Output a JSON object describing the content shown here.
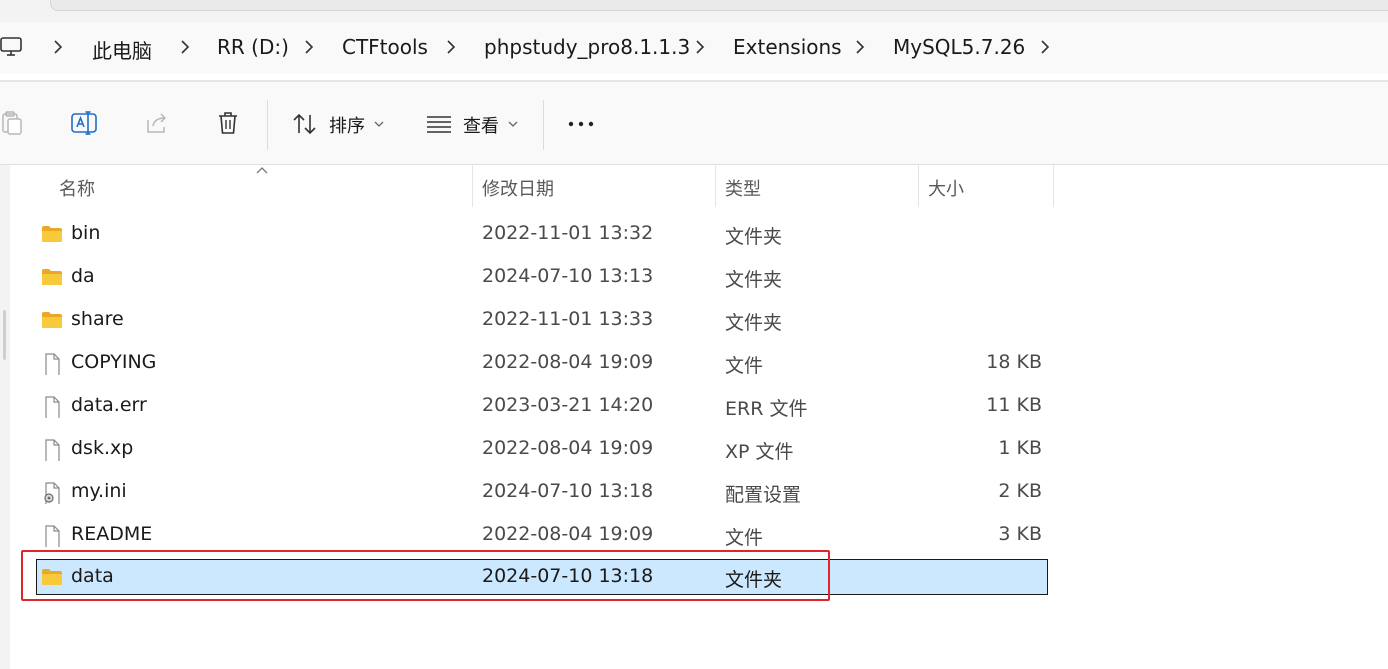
{
  "breadcrumb": {
    "items": [
      "此电脑",
      "RR (D:)",
      "CTFtools",
      "phpstudy_pro8.1.1.3",
      "Extensions",
      "MySQL5.7.26"
    ]
  },
  "toolbar": {
    "sort_label": "排序",
    "view_label": "查看",
    "more_label": "..."
  },
  "columns": {
    "name": "名称",
    "date": "修改日期",
    "type": "类型",
    "size": "大小"
  },
  "files": [
    {
      "name": "bin",
      "date": "2022-11-01 13:32",
      "type": "文件夹",
      "size": "",
      "icon": "folder-icon"
    },
    {
      "name": "da",
      "date": "2024-07-10 13:13",
      "type": "文件夹",
      "size": "",
      "icon": "folder-icon"
    },
    {
      "name": "share",
      "date": "2022-11-01 13:33",
      "type": "文件夹",
      "size": "",
      "icon": "folder-icon"
    },
    {
      "name": "COPYING",
      "date": "2022-08-04 19:09",
      "type": "文件",
      "size": "18 KB",
      "icon": "file-icon"
    },
    {
      "name": "data.err",
      "date": "2023-03-21 14:20",
      "type": "ERR 文件",
      "size": "11 KB",
      "icon": "file-icon"
    },
    {
      "name": "dsk.xp",
      "date": "2022-08-04 19:09",
      "type": "XP 文件",
      "size": "1 KB",
      "icon": "file-icon"
    },
    {
      "name": "my.ini",
      "date": "2024-07-10 13:18",
      "type": "配置设置",
      "size": "2 KB",
      "icon": "settings-file-icon"
    },
    {
      "name": "README",
      "date": "2022-08-04 19:09",
      "type": "文件",
      "size": "3 KB",
      "icon": "file-icon"
    },
    {
      "name": "data",
      "date": "2024-07-10 13:18",
      "type": "文件夹",
      "size": "",
      "icon": "folder-icon",
      "selected": true
    }
  ],
  "colors": {
    "selection_bg": "#cce8ff",
    "annotation_red": "#e0242c",
    "folder_yellow": "#f8c93a"
  }
}
